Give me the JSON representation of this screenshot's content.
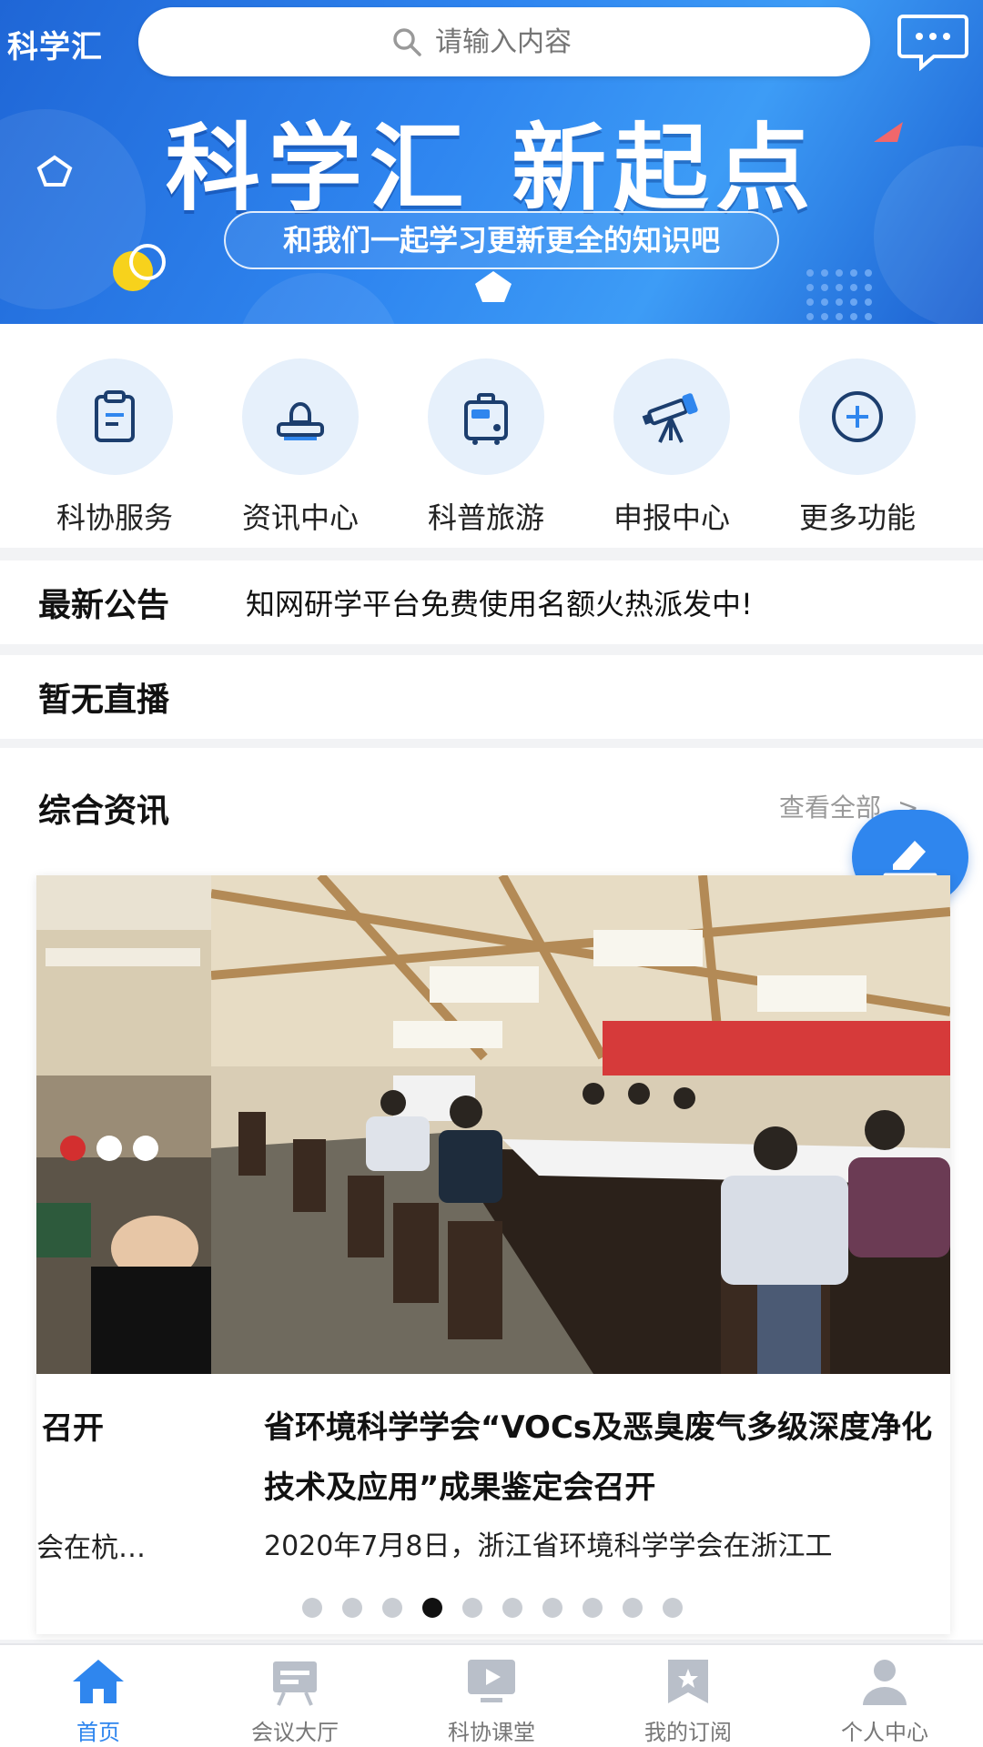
{
  "header": {
    "app_title": "科学汇",
    "search_placeholder": "请输入内容"
  },
  "banner": {
    "slogan": "科学汇 新起点",
    "subtitle": "和我们一起学习更新更全的知识吧"
  },
  "quick_menu": [
    {
      "label": "科协服务",
      "icon": "clipboard-icon"
    },
    {
      "label": "资讯中心",
      "icon": "user-stamp-icon"
    },
    {
      "label": "科普旅游",
      "icon": "suitcase-icon"
    },
    {
      "label": "申报中心",
      "icon": "telescope-icon"
    },
    {
      "label": "更多功能",
      "icon": "plus-circle-icon"
    }
  ],
  "notice": {
    "label": "最新公告",
    "text": "知网研学平台免费使用名额火热派发中!"
  },
  "live": {
    "label": "暂无直播"
  },
  "news": {
    "section_title": "综合资讯",
    "view_all": "查看全部",
    "prev_item": {
      "title_tail": "召开",
      "summary_tail": "会在杭…"
    },
    "current_item": {
      "title": "省环境科学学会“VOCs及恶臭废气多级深度净化技术及应用”成果鉴定会召开",
      "summary": "2020年7月8日，浙江省环境科学学会在浙江工"
    },
    "slide_count": 10,
    "active_slide": 4
  },
  "tabbar": [
    {
      "label": "首页",
      "icon": "home-icon",
      "active": true
    },
    {
      "label": "会议大厅",
      "icon": "meeting-hall-icon",
      "active": false
    },
    {
      "label": "科协课堂",
      "icon": "video-class-icon",
      "active": false
    },
    {
      "label": "我的订阅",
      "icon": "subscription-icon",
      "active": false
    },
    {
      "label": "个人中心",
      "icon": "profile-icon",
      "active": false
    }
  ],
  "colors": {
    "primary": "#2f86ee",
    "banner_start": "#1f66d6",
    "banner_end": "#3d9cf6",
    "icon_bg": "#e6f0fb"
  }
}
